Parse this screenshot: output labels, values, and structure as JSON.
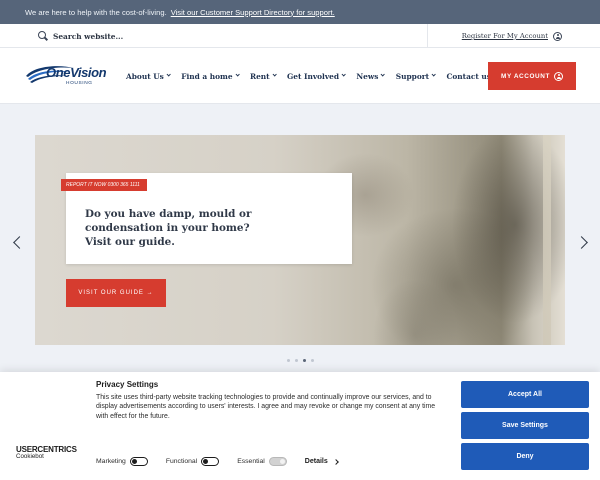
{
  "banner": {
    "text": "We are here to help with the cost-of-living.",
    "link": "Visit our Customer Support Directory for support."
  },
  "utility": {
    "search_placeholder": "Search website...",
    "register_label": "Register For My Account"
  },
  "header": {
    "logo_main": "OneVision",
    "logo_sub": "HOUSING",
    "nav": [
      {
        "label": "About Us",
        "dropdown": true
      },
      {
        "label": "Find a home",
        "dropdown": true
      },
      {
        "label": "Rent",
        "dropdown": true
      },
      {
        "label": "Get Involved",
        "dropdown": true
      },
      {
        "label": "News",
        "dropdown": true
      },
      {
        "label": "Support",
        "dropdown": true
      },
      {
        "label": "Contact us",
        "dropdown": false
      }
    ],
    "account_button": "MY ACCOUNT"
  },
  "hero": {
    "tag": "REPORT IT NOW 0300 365 1111",
    "title": "Do you have damp, mould or condensation in your home? Visit our guide.",
    "cta": "VISIT OUR GUIDE →",
    "slides_total": 4,
    "active_slide": 3
  },
  "cookie_banner": {
    "brand_main": "USERCENTRICS",
    "brand_sub": "Cookiebot",
    "title": "Privacy Settings",
    "text": "This site uses third-party website tracking technologies to provide and continually improve our services, and to display advertisements according to users' interests. I agree and may revoke or change my consent at any time with effect for the future.",
    "toggles": [
      {
        "label": "Marketing",
        "on": false,
        "disabled": false
      },
      {
        "label": "Functional",
        "on": false,
        "disabled": false
      },
      {
        "label": "Essential",
        "on": true,
        "disabled": true
      }
    ],
    "details_label": "Details",
    "buttons": {
      "accept": "Accept All",
      "save": "Save Settings",
      "deny": "Deny"
    }
  },
  "colors": {
    "banner_bg": "#56657a",
    "brand_red": "#d63c2f",
    "brand_navy": "#13386d",
    "consent_blue": "#1f5bb8"
  }
}
